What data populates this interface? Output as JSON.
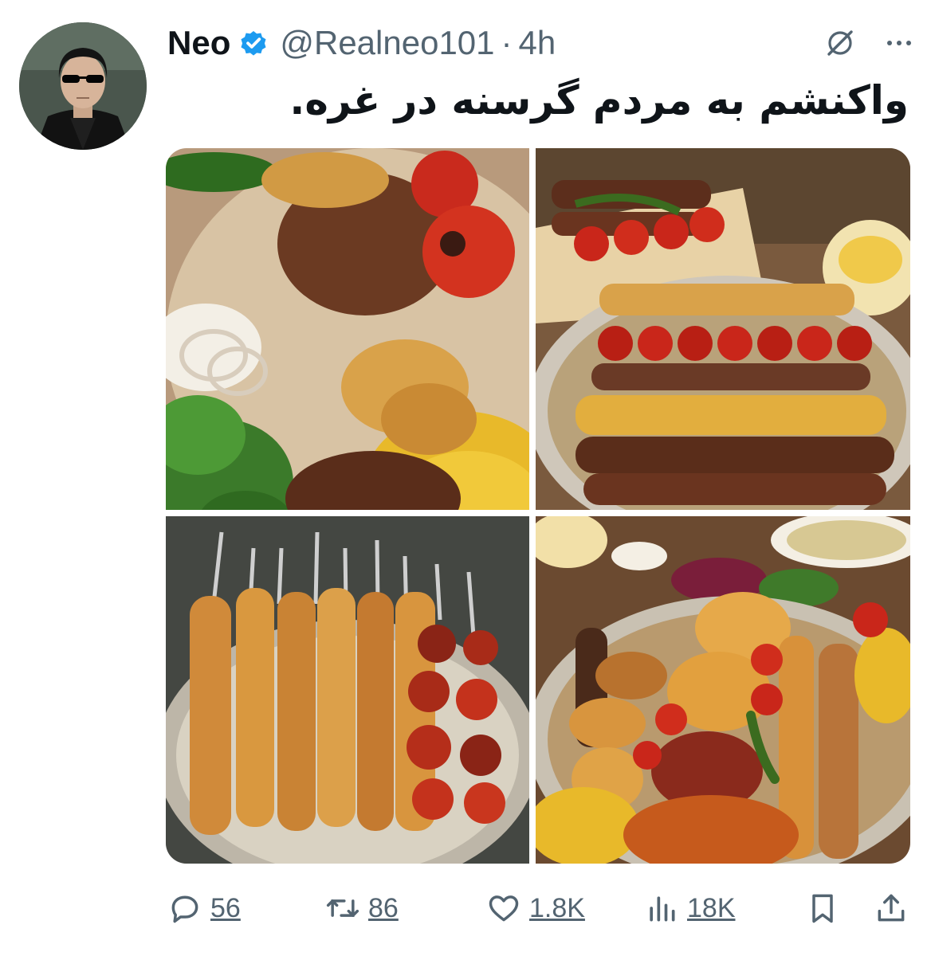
{
  "tweet": {
    "author": {
      "display_name": "Neo",
      "handle": "@Realneo101",
      "verified": true,
      "avatar_icon": "avatar-man-sunglasses"
    },
    "separator": "·",
    "time": "4h",
    "text": "واکنشم به مردم گرسنه در غره.",
    "header_icons": [
      "grok-icon",
      "more-icon"
    ],
    "media": [
      {
        "name": "photo-kebab-platter-lamb",
        "icon": "food-photo"
      },
      {
        "name": "photo-kebab-platter-koobideh",
        "icon": "food-photo"
      },
      {
        "name": "photo-chicken-skewers",
        "icon": "food-photo"
      },
      {
        "name": "photo-mixed-feast",
        "icon": "food-photo"
      }
    ]
  },
  "actions": {
    "reply_count": "56",
    "retweet_count": "86",
    "like_count": "1.8K",
    "views_count": "18K"
  },
  "colors": {
    "text_primary": "#0f1419",
    "text_secondary": "#536471",
    "verified_blue": "#1d9bf0"
  }
}
